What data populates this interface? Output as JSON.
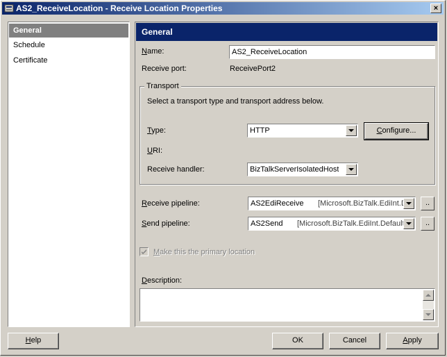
{
  "window": {
    "title": "AS2_ReceiveLocation - Receive Location Properties",
    "close": "×"
  },
  "nav": {
    "items": [
      {
        "label": "General"
      },
      {
        "label": "Schedule"
      },
      {
        "label": "Certificate"
      }
    ]
  },
  "general": {
    "header": "General",
    "name_label_u": "N",
    "name_label_rest": "ame:",
    "name_value": "AS2_ReceiveLocation",
    "receive_port_label": "Receive port:",
    "receive_port_value": "ReceivePort2",
    "transport": {
      "title": "Transport",
      "instruction": "Select a transport type and transport address below.",
      "type_label_u": "T",
      "type_label_rest": "ype:",
      "type_value": "HTTP",
      "configure_u": "C",
      "configure_rest": "onfigure...",
      "uri_label_u": "U",
      "uri_label_rest": "RI:",
      "handler_label": "Receive handler:",
      "handler_value": "BizTalkServerIsolatedHost"
    },
    "receive_pipeline_label_u": "R",
    "receive_pipeline_label_rest": "eceive pipeline:",
    "receive_pipeline_name": "AS2EdiReceive",
    "receive_pipeline_assembly": "[Microsoft.BizTalk.EdiInt.D",
    "send_pipeline_label_u": "S",
    "send_pipeline_label_rest": "end pipeline:",
    "send_pipeline_name": "AS2Send",
    "send_pipeline_assembly": "[Microsoft.BizTalk.EdiInt.Defaultf",
    "ellipsis": "..",
    "primary_location_u": "M",
    "primary_location_rest": "ake this the primary location",
    "description_label_u": "D",
    "description_label_rest": "escription:",
    "description_value": ""
  },
  "buttons": {
    "help_u": "H",
    "help_rest": "elp",
    "ok": "OK",
    "cancel": "Cancel",
    "apply_u": "A",
    "apply_rest": "pply"
  }
}
